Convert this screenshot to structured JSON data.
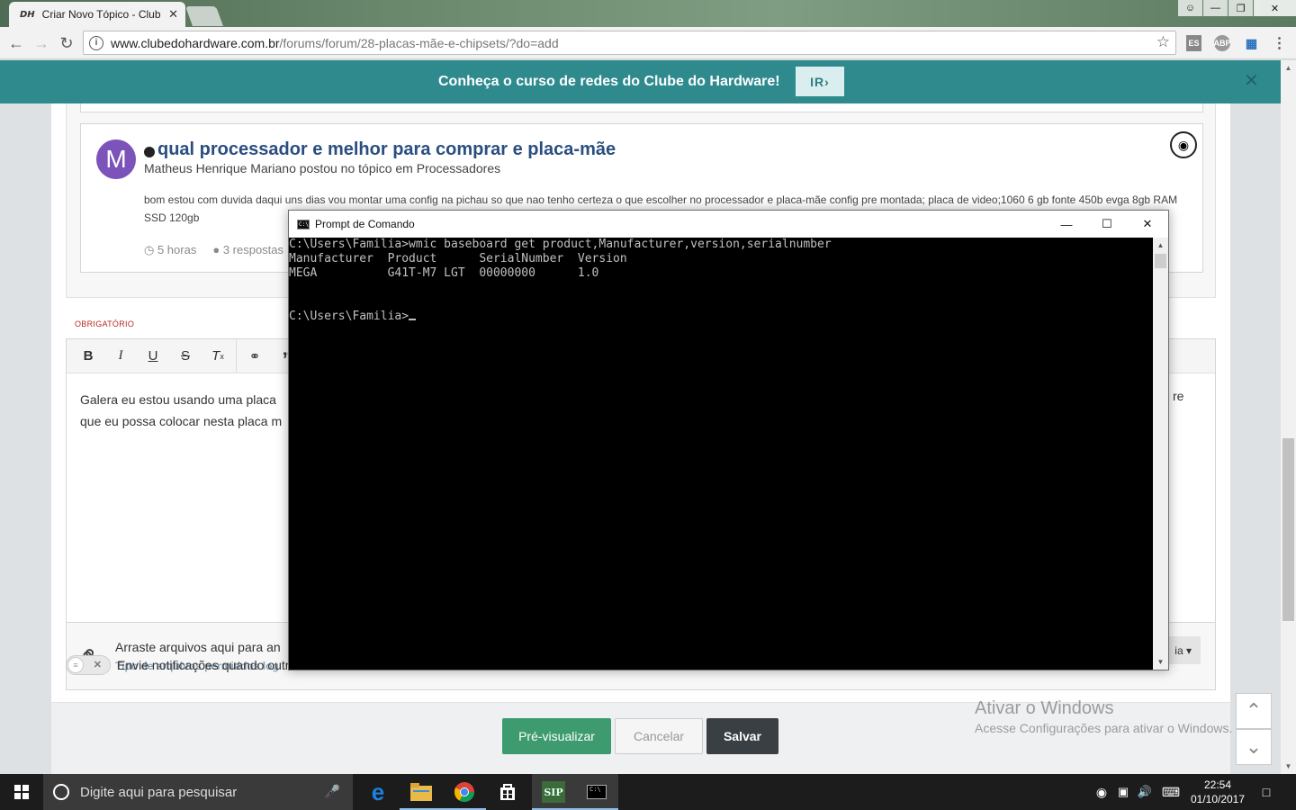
{
  "browser": {
    "tab_title": "Criar Novo Tópico - Club",
    "tab_favicon": "DH",
    "url_host": "www.clubedohardware.com.br",
    "url_path": "/forums/forum/28-placas-mãe-e-chipsets/?do=add",
    "ext1": "ES",
    "ext2": "ABP"
  },
  "banner": {
    "text": "Conheça o curso de redes do Clube do Hardware!",
    "button": "IR",
    "button_icon": "chevron-right-icon"
  },
  "activity_card": {
    "avatar_letter": "M",
    "title": "qual processador e melhor para comprar e placa-mãe",
    "meta": "Matheus Henrique Mariano postou no tópico em Processadores",
    "body": "bom estou com duvida daqui uns dias vou montar uma config na pichau so que nao tenho certeza o que escolher no processador e placa-mãe config pre montada; placa de video;1060 6 gb fonte 450b evga 8gb RAM SSD 120gb",
    "time": "5 horas",
    "replies": "3 respostas"
  },
  "editor": {
    "required_label": "OBRIGATÓRIO",
    "toolbar": [
      "B",
      "I",
      "U",
      "S",
      "Tx",
      "link",
      "quote"
    ],
    "text_line1": "Galera eu estou usando uma placa",
    "text_line2": "que eu possa colocar nesta placa m",
    "text_tail": "re"
  },
  "attachments": {
    "title": "Arraste arquivos aqui para an",
    "subtitle": "Tipo de arquivos permitidos log",
    "button_tail": "ia"
  },
  "notify": {
    "label": "Envie notificações quando outr"
  },
  "actions": {
    "preview": "Pré-visualizar",
    "cancel": "Cancelar",
    "save": "Salvar"
  },
  "watermark": {
    "line1": "Ativar o Windows",
    "line2": "Acesse Configurações para ativar o Windows."
  },
  "cmd": {
    "title": "Prompt de Comando",
    "lines": [
      "C:\\Users\\Familia>wmic baseboard get product,Manufacturer,version,serialnumber",
      "Manufacturer  Product      SerialNumber  Version",
      "MEGA          G41T-M7 LGT  00000000      1.0",
      "",
      "",
      "C:\\Users\\Familia>"
    ]
  },
  "taskbar": {
    "search_placeholder": "Digite aqui para pesquisar",
    "time": "22:54",
    "date": "01/10/2017"
  },
  "colors": {
    "banner": "#2f8a8e",
    "title_link": "#2a4e80",
    "preview_button": "#3d9b6f",
    "save_button": "#3a3f44",
    "required": "#b7281e"
  }
}
